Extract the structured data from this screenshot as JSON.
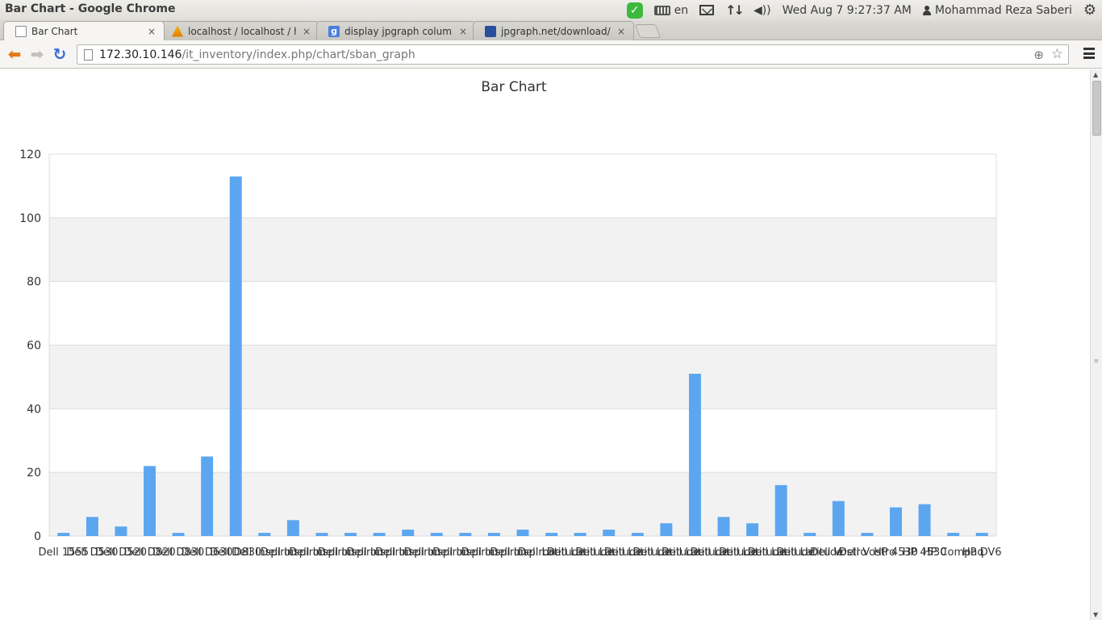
{
  "window": {
    "title": "Bar Chart - Google Chrome"
  },
  "panel": {
    "keyboard_layout": "en",
    "datetime": "Wed Aug  7  9:27:37 AM",
    "user": "Mohammad Reza Saberi",
    "icons": [
      "check-shield-icon",
      "keyboard-icon",
      "mail-icon",
      "network-icon",
      "volume-icon",
      "user-icon",
      "gear-icon"
    ]
  },
  "tabs": [
    {
      "label": "Bar Chart",
      "icon": "page-icon",
      "active": true
    },
    {
      "label": "localhost / localhost / hr /",
      "icon": "phpmyadmin-icon",
      "active": false
    },
    {
      "label": "display jpgraph column na",
      "icon": "google-icon",
      "active": false
    },
    {
      "label": "jpgraph.net/download/ma",
      "icon": "jpgraph-icon",
      "active": false
    }
  ],
  "close_glyph": "×",
  "toolbar": {
    "url_host": "172.30.10.146",
    "url_path": "/it_inventory/index.php/chart/sban_graph"
  },
  "chart_data": {
    "type": "bar",
    "title": "Bar Chart",
    "xlabel": "",
    "ylabel": "",
    "ylim": [
      0,
      120
    ],
    "yticks": [
      0,
      20,
      40,
      60,
      80,
      100,
      120
    ],
    "grid": true,
    "bar_color": "#5ca6f0",
    "band_color": "#f2f2f2",
    "categories_visible": [
      "Dell 1555",
      "Dell D530",
      "Dell D520",
      "Dell D820",
      "Dell D830",
      "HP Compaq",
      "HP DV6"
    ],
    "values": [
      1,
      6,
      3,
      22,
      1,
      25,
      113,
      1,
      5,
      1,
      1,
      1,
      2,
      1,
      1,
      1,
      2,
      1,
      1,
      2,
      1,
      4,
      51,
      6,
      4,
      16,
      1,
      11,
      1,
      9,
      10,
      1,
      1
    ],
    "x_labels": [
      "Dell 1555",
      "Dell D530",
      "Dell D520",
      "Dell D820",
      "Dell D830",
      "Dell D630",
      "Dell D830",
      "Dell Inspiron",
      "Dell Inspiron",
      "Dell Inspiron",
      "Dell Inspiron",
      "Dell Inspiron",
      "Dell Inspiron",
      "Dell Inspiron",
      "Dell Inspiron",
      "Dell Inspiron",
      "Dell Inspiron",
      "Dell Latitude",
      "Dell Latitude",
      "Dell Latitude",
      "Dell Latitude",
      "Dell Latitude",
      "Dell Latitude",
      "Dell Latitude",
      "Dell Latitude",
      "Dell Latitude",
      "Dell Latitude",
      "Dell Vostro",
      "Dell Vostro",
      "HP 4530",
      "HP 4530",
      "HP Compaq",
      "HP DV6"
    ]
  }
}
